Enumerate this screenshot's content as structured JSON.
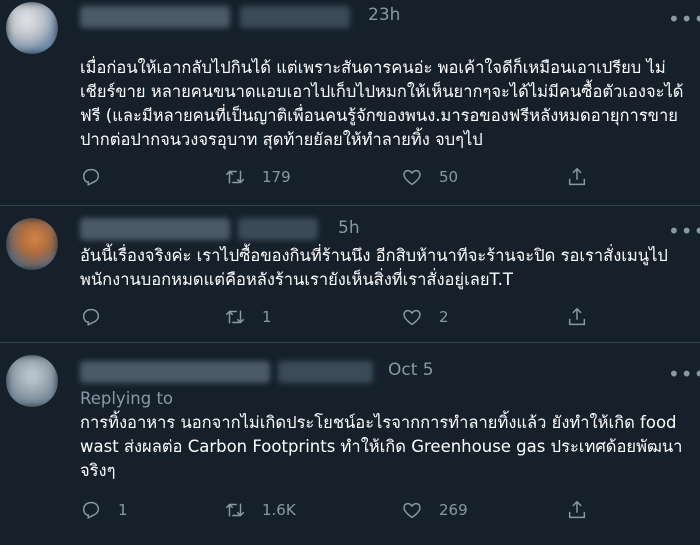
{
  "tweets": [
    {
      "time": "23h",
      "text": "เมื่อก่อนให้เอากลับไปกินได้ แต่เพราะสันดารคนอ่ะ พอเค้าใจดีก็เหมือนเอาเปรียบ ไม่เชียร์ขาย หลายคนขนาดแอบเอาไปเก็บไปหมกให้เห็นยากๆจะได้ไม่มีคนซื้อตัวเองจะได้ฟรี (และมีหลายคนที่เป็นญาติเพื่อนคนรู้จักของพนง.มารอของฟรีหลังหมดอายุการขาย ปากต่อปากจนวงจรอุบาท สุดท้ายยัลยให้ทำลายทิ้ง จบๆไป",
      "replies": "",
      "retweets": "179",
      "likes": "50"
    },
    {
      "time": "5h",
      "text": "อันนี้เรื่องจริงค่ะ เราไปซื้อของกินที่ร้านนึง อีกสิบห้านาทีจะร้านจะปิด รอเราสั่งเมนูไป พนักงานบอกหมดแต่คือหลังร้านเรายังเห็นสิ่งที่เราสั่งอยู่เลยT.T",
      "replies": "",
      "retweets": "1",
      "likes": "2"
    },
    {
      "time": "Oct 5",
      "replying_to": "Replying to",
      "text": "การทิ้งอาหาร นอกจากไม่เกิดประโยชน์อะไรจากการทำลายทิ้งแล้ว ยังทำให้เกิด food wast ส่งผลต่อ Carbon Footprints ทำให้เกิด Greenhouse gas ประเทศด้อยพัฒนาจริงๆ",
      "replies": "1",
      "retweets": "1.6K",
      "likes": "269"
    }
  ],
  "more_icon": "•••",
  "icons": [
    "reply-icon",
    "retweet-icon",
    "like-icon",
    "share-icon",
    "more-icon"
  ]
}
